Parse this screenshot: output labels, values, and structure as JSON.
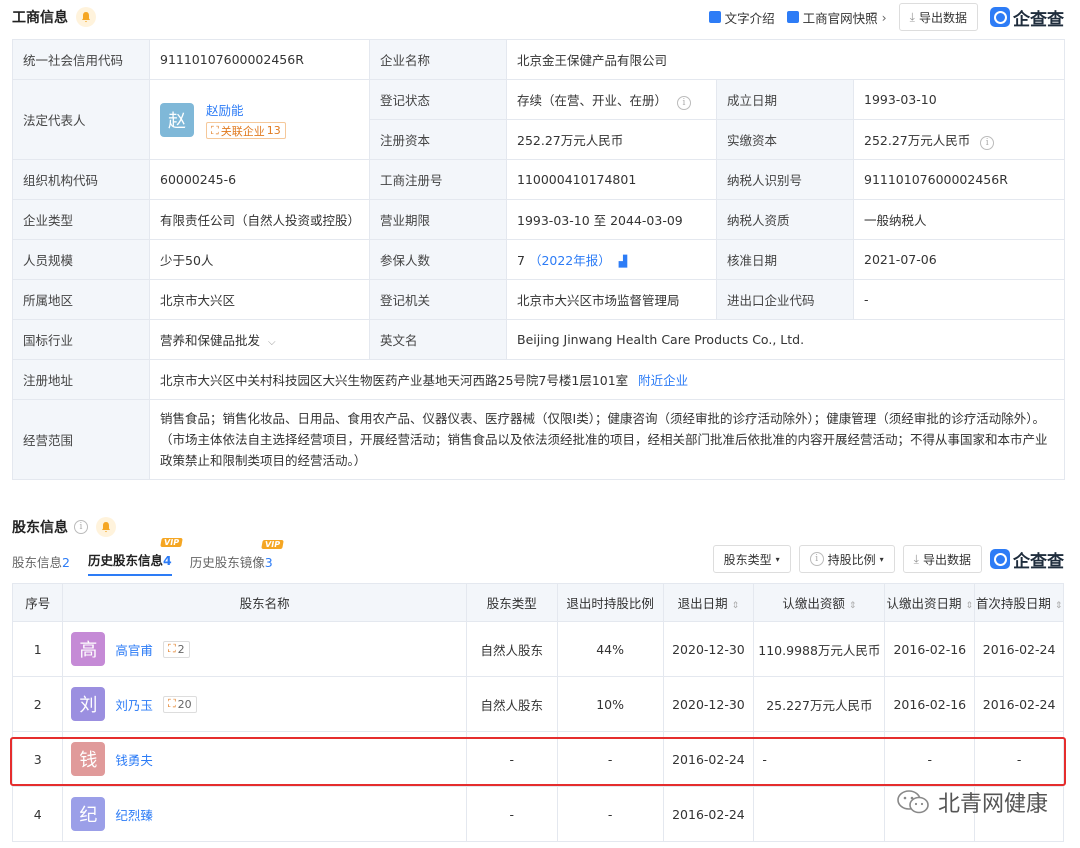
{
  "biz": {
    "title": "工商信息",
    "text_intro": "文字介绍",
    "snapshot": "工商官网快照",
    "export": "导出数据",
    "logo": "企查查"
  },
  "rows": {
    "credit_code_label": "统一社会信用代码",
    "credit_code": "91110107600002456R",
    "company_name_label": "企业名称",
    "company_name": "北京金王保健产品有限公司",
    "legal_rep_label": "法定代表人",
    "legal_rep_avatar": "赵",
    "legal_rep_name": "赵励能",
    "legal_rep_tag": "关联企业",
    "legal_rep_tag_count": "13",
    "reg_status_label": "登记状态",
    "reg_status": "存续（在营、开业、在册）",
    "found_date_label": "成立日期",
    "found_date": "1993-03-10",
    "reg_capital_label": "注册资本",
    "reg_capital": "252.27万元人民币",
    "paid_capital_label": "实缴资本",
    "paid_capital": "252.27万元人民币",
    "org_code_label": "组织机构代码",
    "org_code": "60000245-6",
    "biz_reg_no_label": "工商注册号",
    "biz_reg_no": "110000410174801",
    "taxpayer_id_label": "纳税人识别号",
    "taxpayer_id": "91110107600002456R",
    "company_type_label": "企业类型",
    "company_type": "有限责任公司（自然人投资或控股）",
    "biz_term_label": "营业期限",
    "biz_term": "1993-03-10 至 2044-03-09",
    "taxpayer_qual_label": "纳税人资质",
    "taxpayer_qual": "一般纳税人",
    "staff_size_label": "人员规模",
    "staff_size": "少于50人",
    "insured_label": "参保人数",
    "insured_count": "7",
    "insured_year": "（2022年报）",
    "approval_date_label": "核准日期",
    "approval_date": "2021-07-06",
    "region_label": "所属地区",
    "region": "北京市大兴区",
    "reg_authority_label": "登记机关",
    "reg_authority": "北京市大兴区市场监督管理局",
    "import_export_label": "进出口企业代码",
    "import_export": "-",
    "industry_label": "国标行业",
    "industry": "营养和保健品批发",
    "english_name_label": "英文名",
    "english_name": "Beijing Jinwang Health Care Products Co., Ltd.",
    "address_label": "注册地址",
    "address": "北京市大兴区中关村科技园区大兴生物医药产业基地天河西路25号院7号楼1层101室",
    "nearby": "附近企业",
    "scope_label": "经营范围",
    "scope": "销售食品；销售化妆品、日用品、食用农产品、仪器仪表、医疗器械（仅限I类）；健康咨询（须经审批的诊疗活动除外）；健康管理（须经审批的诊疗活动除外）。（市场主体依法自主选择经营项目，开展经营活动；销售食品以及依法须经批准的项目，经相关部门批准后依批准的内容开展经营活动；不得从事国家和本市产业政策禁止和限制类项目的经营活动。）"
  },
  "sh": {
    "title": "股东信息",
    "tabs": [
      {
        "label": "股东信息",
        "count": "2"
      },
      {
        "label": "历史股东信息",
        "count": "4"
      },
      {
        "label": "历史股东镜像",
        "count": "3"
      }
    ],
    "vip": "VIP",
    "type_btn": "股东类型",
    "ratio_btn": "持股比例",
    "export": "导出数据",
    "logo": "企查查",
    "columns": [
      "序号",
      "股东名称",
      "股东类型",
      "退出时持股比例",
      "退出日期",
      "认缴出资额",
      "认缴出资日期",
      "首次持股日期"
    ],
    "rows": [
      {
        "no": "1",
        "avatar": "高",
        "name": "高官甫",
        "tag": "2",
        "type": "自然人股东",
        "ratio": "44%",
        "exit": "2020-12-30",
        "amount": "110.9988万元人民币",
        "sub_date": "2016-02-16",
        "first_date": "2016-02-24"
      },
      {
        "no": "2",
        "avatar": "刘",
        "name": "刘乃玉",
        "tag": "20",
        "type": "自然人股东",
        "ratio": "10%",
        "exit": "2020-12-30",
        "amount": "25.227万元人民币",
        "sub_date": "2016-02-16",
        "first_date": "2016-02-24"
      },
      {
        "no": "3",
        "avatar": "钱",
        "name": "钱勇夫",
        "tag": "",
        "type": "-",
        "ratio": "-",
        "exit": "2016-02-24",
        "amount": "-",
        "sub_date": "-",
        "first_date": "-"
      },
      {
        "no": "4",
        "avatar": "纪",
        "name": "纪烈臻",
        "tag": "",
        "type": "-",
        "ratio": "-",
        "exit": "2016-02-24",
        "amount": "",
        "sub_date": "",
        "first_date": ""
      }
    ]
  },
  "colors": {
    "accent": "#2d7cf6",
    "avatar_zhao": "#7fb8d8",
    "avatar_gao": "#c58ad6",
    "avatar_liu": "#9b8fe0",
    "avatar_qian": "#e09a9a",
    "avatar_ji": "#9b9fe8",
    "highlight": "#e52d2d"
  },
  "watermark": "北青网健康"
}
